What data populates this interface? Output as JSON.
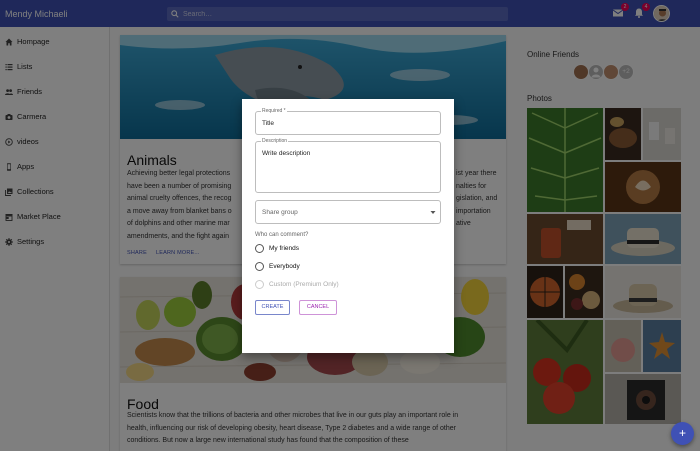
{
  "app": {
    "user_name": "Mendy Michaeli",
    "search_placeholder": "Search…",
    "mail_badge": "2",
    "notif_badge": "4"
  },
  "sidebar": {
    "items": [
      {
        "label": "Hompage",
        "icon": "home-icon"
      },
      {
        "label": "Lists",
        "icon": "list-icon"
      },
      {
        "label": "Friends",
        "icon": "people-icon"
      },
      {
        "label": "Carmera",
        "icon": "camera-icon"
      },
      {
        "label": "videos",
        "icon": "play-circle-icon"
      },
      {
        "label": "Apps",
        "icon": "phone-icon"
      },
      {
        "label": "Collections",
        "icon": "collections-icon"
      },
      {
        "label": "Market Place",
        "icon": "store-icon"
      },
      {
        "label": "Settings",
        "icon": "gear-icon"
      }
    ]
  },
  "feed": {
    "card1": {
      "title": "Animals",
      "lines": [
        "Achieving better legal protections",
        "have been a number of promising",
        "animal cruelty offences, the recog",
        "a move away from blanket bans o",
        "of dolphins and other marine mar",
        "amendments, and the fight again"
      ],
      "right_lines": [
        "ist year there",
        "nalties for",
        "gislation, and",
        "importation",
        "ative",
        ""
      ],
      "share": "SHARE",
      "learn_more": "LEARN MORE..."
    },
    "card2": {
      "title": "Food",
      "lines": [
        "Scientists know that the trillions of bacteria and other microbes that live in our guts play an important role in",
        "health, influencing our risk of developing obesity, heart disease, Type 2 diabetes and a wide range of other",
        "conditions. But now a large new international study has found that the composition of these"
      ]
    }
  },
  "right": {
    "online_friends": "Online Friends",
    "more_friends": "+2",
    "photos": "Photos"
  },
  "dialog": {
    "title_label": "Required *",
    "title_value": "Title",
    "desc_label": "Description",
    "desc_value": "Write description",
    "share_group_placeholder": "Share group",
    "comment_question": "Who can comment?",
    "options": [
      "My friends",
      "Everybody",
      "Custom (Premium Only)"
    ],
    "create": "CREATE",
    "cancel": "CANCEL"
  },
  "colors": {
    "primary": "#3f51b5",
    "secondary": "#9c27b0",
    "badge": "#f50057"
  }
}
